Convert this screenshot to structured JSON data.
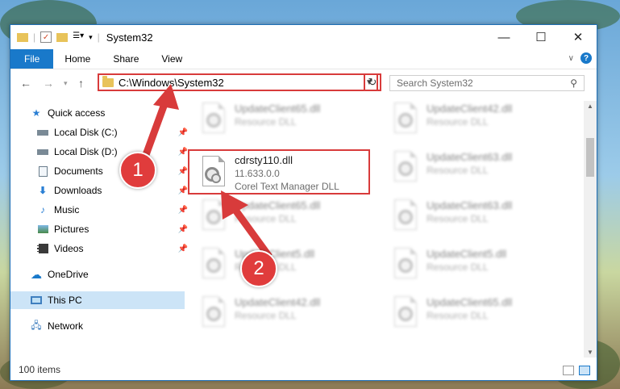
{
  "window": {
    "title": "System32"
  },
  "ribbon": {
    "tabs": [
      "File",
      "Home",
      "Share",
      "View"
    ]
  },
  "address": {
    "path": "C:\\Windows\\System32"
  },
  "search": {
    "placeholder": "Search System32"
  },
  "sidebar": {
    "items": [
      {
        "label": "Quick access",
        "icon": "star-icon",
        "pinned": false
      },
      {
        "label": "Local Disk (C:)",
        "icon": "drive-icon",
        "pinned": true
      },
      {
        "label": "Local Disk (D:)",
        "icon": "drive-icon",
        "pinned": true
      },
      {
        "label": "Documents",
        "icon": "documents-icon",
        "pinned": true
      },
      {
        "label": "Downloads",
        "icon": "download-icon",
        "pinned": true
      },
      {
        "label": "Music",
        "icon": "music-icon",
        "pinned": true
      },
      {
        "label": "Pictures",
        "icon": "pictures-icon",
        "pinned": true
      },
      {
        "label": "Videos",
        "icon": "videos-icon",
        "pinned": true
      },
      {
        "label": "OneDrive",
        "icon": "cloud-icon",
        "pinned": false
      },
      {
        "label": "This PC",
        "icon": "computer-icon",
        "pinned": false
      },
      {
        "label": "Network",
        "icon": "network-icon",
        "pinned": false
      }
    ]
  },
  "files": {
    "focused": {
      "name": "cdrsty110.dll",
      "version": "11.633.0.0",
      "description": "Corel Text Manager DLL"
    },
    "blurred": [
      {
        "name": "UpdateClient65.dll",
        "sub": "Resource DLL"
      },
      {
        "name": "UpdateClient42.dll",
        "sub": "Resource DLL"
      },
      {
        "name": "UpdateClient63.dll",
        "sub": "Resource DLL"
      },
      {
        "name": "UpdateClient65.dll",
        "sub": "Resource DLL"
      },
      {
        "name": "UpdateClient63.dll",
        "sub": "Resource DLL"
      },
      {
        "name": "UpdateClient5.dll",
        "sub": "Resource DLL"
      },
      {
        "name": "UpdateClient5.dll",
        "sub": "Resource DLL"
      },
      {
        "name": "UpdateClient42.dll",
        "sub": "Resource DLL"
      },
      {
        "name": "UpdateClient65.dll",
        "sub": "Resource DLL"
      }
    ]
  },
  "status": {
    "count": "100 items"
  },
  "callouts": [
    "1",
    "2"
  ],
  "colors": {
    "accent": "#1979ca",
    "highlight": "#d83b3b",
    "selected": "#cce4f7"
  }
}
